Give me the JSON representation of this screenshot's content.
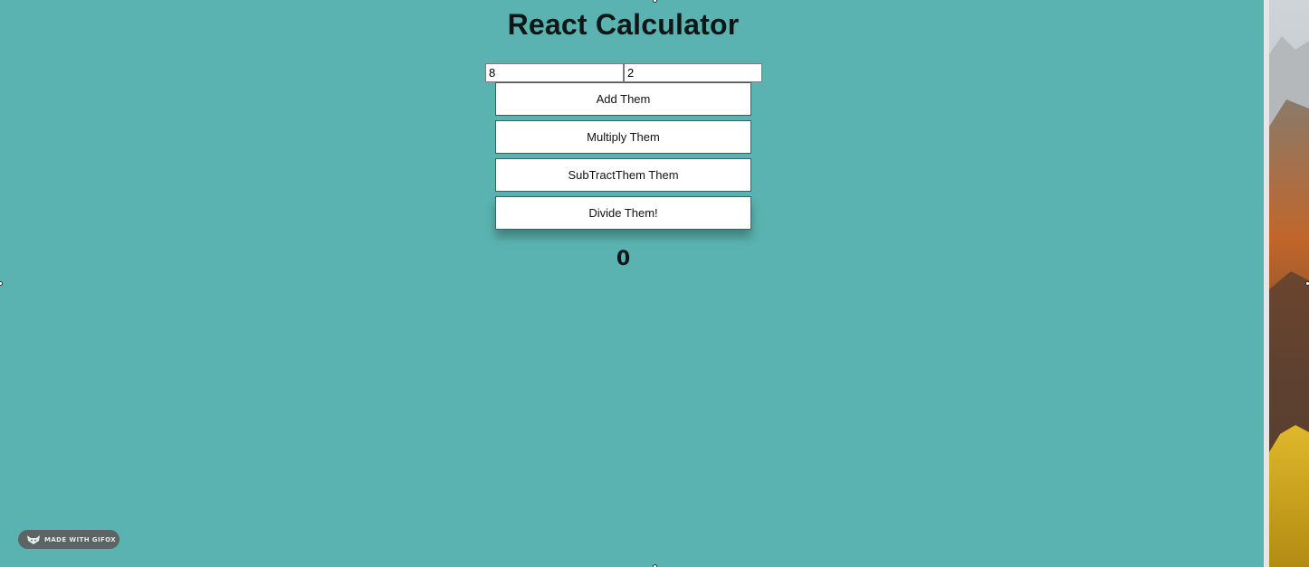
{
  "app": {
    "title": "React Calculator",
    "background_color": "#5ab3b0"
  },
  "inputs": {
    "first_value": "8",
    "second_value": "2"
  },
  "buttons": {
    "add_label": "Add Them",
    "multiply_label": "Multiply Them",
    "subtract_label": "SubTractThem Them",
    "divide_label": "Divide Them!"
  },
  "result": {
    "value": "0"
  },
  "watermark": {
    "text": "MADE WITH GIFOX",
    "icon": "fox-icon"
  },
  "desktop": {
    "image": "mountain-wallpaper"
  }
}
